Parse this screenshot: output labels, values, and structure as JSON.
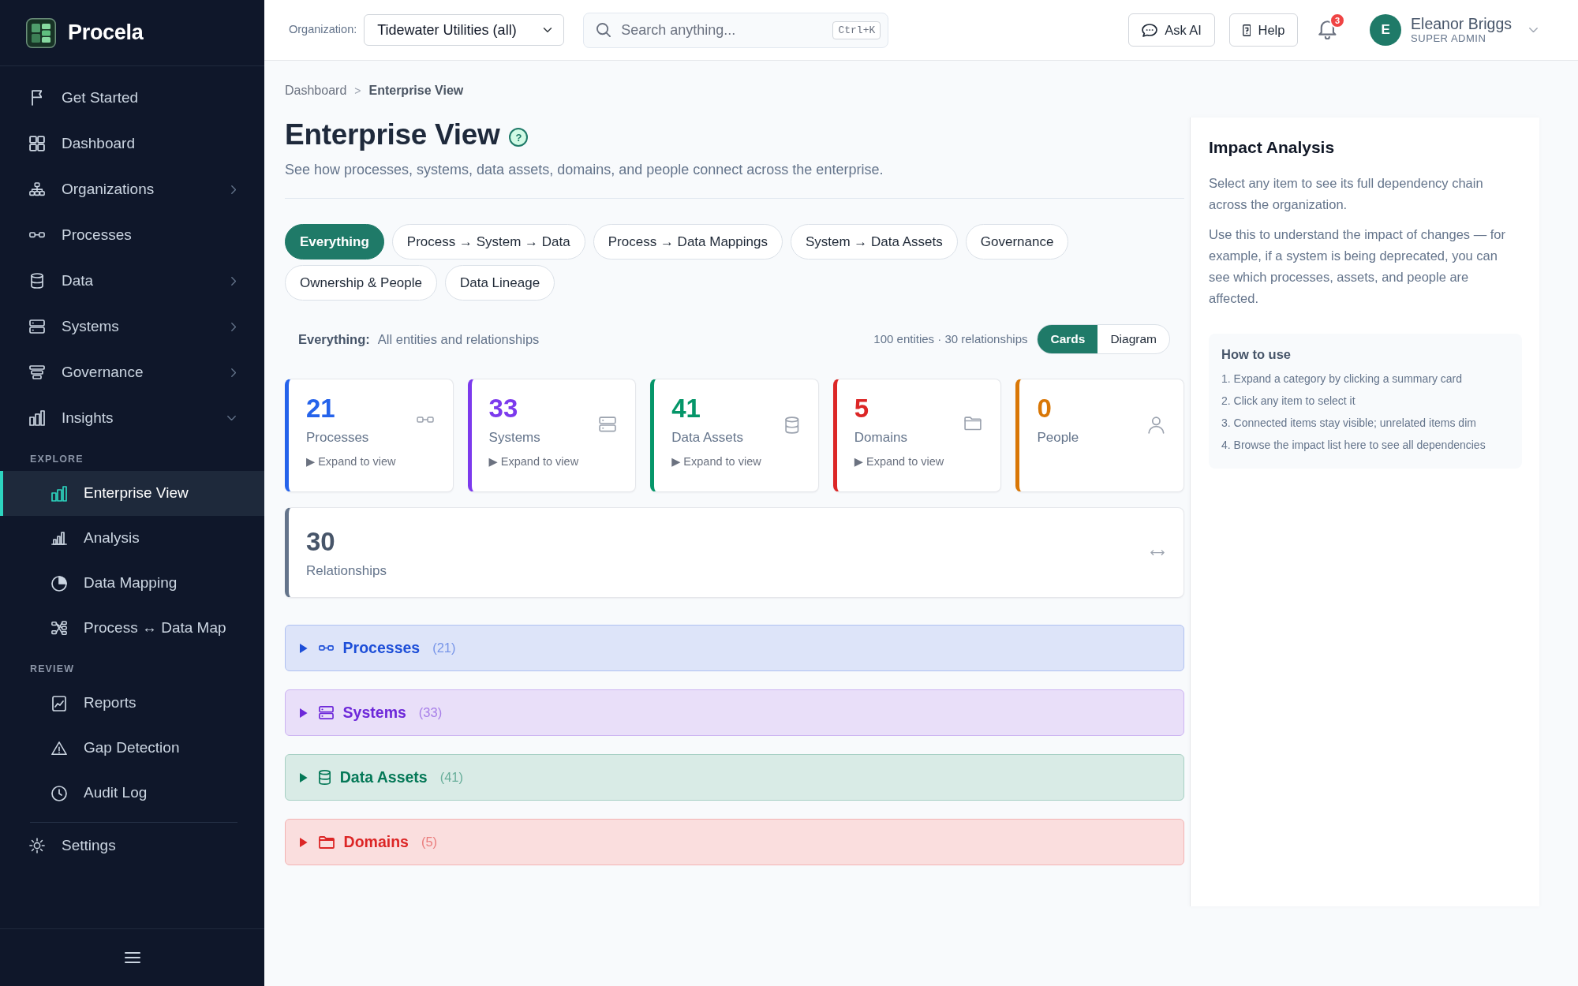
{
  "sidebar": {
    "brand": "Procela",
    "nav": [
      {
        "label": "Get Started",
        "selected": false
      },
      {
        "label": "Dashboard",
        "selected": false
      },
      {
        "label": "Organizations",
        "selected": false,
        "expanded": false
      },
      {
        "label": "Processes",
        "selected": false
      },
      {
        "label": "Data",
        "selected": false,
        "expanded": false
      },
      {
        "label": "Systems",
        "selected": false,
        "expanded": false
      },
      {
        "label": "Governance",
        "selected": false,
        "expanded": false
      },
      {
        "label": "Insights",
        "selected": false,
        "expanded": true,
        "groups": [
          {
            "heading": "EXPLORE",
            "children": [
              {
                "label": "Enterprise View",
                "selected": true
              },
              {
                "label": "Analysis",
                "selected": false
              },
              {
                "label": "Data Mapping",
                "selected": false
              },
              {
                "label": "Process ↔ Data Map",
                "selected": false
              }
            ]
          },
          {
            "heading": "REVIEW",
            "children": [
              {
                "label": "Reports",
                "selected": false
              },
              {
                "label": "Gap Detection",
                "selected": false
              },
              {
                "label": "Audit Log",
                "selected": false
              }
            ]
          }
        ]
      }
    ],
    "bottom_nav": [
      {
        "label": "Settings",
        "selected": false
      }
    ]
  },
  "topbar": {
    "organization": {
      "label": "Organization:",
      "value": "Tidewater Utilities (all)"
    },
    "search": {
      "placeholder": "Search anything...",
      "shortcut": "Ctrl+K"
    },
    "buttons": [
      "Ask AI",
      "Help"
    ],
    "notifications": {
      "count": "3"
    },
    "user": {
      "initial": "E",
      "name": "Eleanor Briggs",
      "role": "SUPER ADMIN"
    }
  },
  "breadcrumb": {
    "items": [
      "Dashboard",
      "Enterprise View"
    ],
    "separator": ">"
  },
  "page": {
    "title": "Enterprise View",
    "help": "?",
    "subtitle": "See how processes, systems, data assets, domains, and people connect across the enterprise."
  },
  "filters": [
    {
      "label": "Everything",
      "selected": true
    },
    {
      "label": "Process → System → Data",
      "selected": false
    },
    {
      "label": "Process → Data Mappings",
      "selected": false
    },
    {
      "label": "System → Data Assets",
      "selected": false
    },
    {
      "label": "Governance",
      "selected": false
    },
    {
      "label": "Ownership & People",
      "selected": false
    },
    {
      "label": "Data Lineage",
      "selected": false
    }
  ],
  "summary": {
    "label": "Everything:",
    "text": "All entities and relationships",
    "counts": "100 entities · 30 relationships",
    "view_toggle": [
      {
        "label": "Cards",
        "selected": true
      },
      {
        "label": "Diagram",
        "selected": false
      }
    ]
  },
  "cards": [
    {
      "count": "21",
      "label": "Processes",
      "action": "▶ Expand to view",
      "color": "#2563eb"
    },
    {
      "count": "33",
      "label": "Systems",
      "action": "▶ Expand to view",
      "color": "#7c3aed"
    },
    {
      "count": "41",
      "label": "Data Assets",
      "action": "▶ Expand to view",
      "color": "#059669"
    },
    {
      "count": "5",
      "label": "Domains",
      "action": "▶ Expand to view",
      "color": "#dc2626"
    },
    {
      "count": "0",
      "label": "People",
      "color": "#d97706"
    }
  ],
  "relationships": {
    "count": "30",
    "label": "Relationships"
  },
  "sections": [
    {
      "title": "Processes",
      "count": "(21)",
      "color": "#1d4ed8",
      "expanded": false
    },
    {
      "title": "Systems",
      "count": "(33)",
      "color": "#6d28d9",
      "expanded": false
    },
    {
      "title": "Data Assets",
      "count": "(41)",
      "color": "#047857",
      "expanded": false
    },
    {
      "title": "Domains",
      "count": "(5)",
      "color": "#dc2626",
      "expanded": false
    }
  ],
  "impact_panel": {
    "title": "Impact Analysis",
    "paragraphs": [
      "Select any item to see its full dependency chain across the organization.",
      "Use this to understand the impact of changes — for example, if a system is being deprecated, you can see which processes, assets, and people are affected."
    ],
    "how_to": {
      "title": "How to use",
      "steps": [
        "1. Expand a category by clicking a summary card",
        "2. Click any item to select it",
        "3. Connected items stay visible; unrelated items dim",
        "4. Browse the impact list here to see all dependencies"
      ]
    }
  }
}
